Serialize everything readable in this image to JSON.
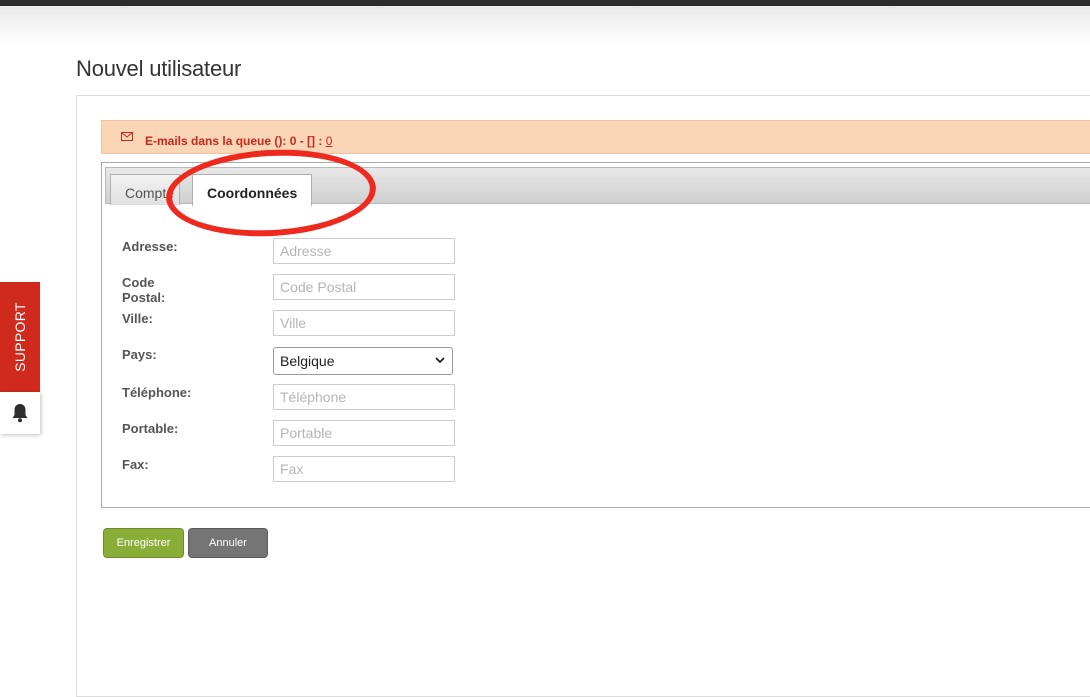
{
  "page": {
    "title": "Nouvel utilisateur"
  },
  "alert": {
    "text": "E-mails dans la queue (): 0 - [] : ",
    "count": "0"
  },
  "tabs": [
    {
      "label": "Compte",
      "active": false
    },
    {
      "label": "Coordonnées",
      "active": true
    }
  ],
  "form": {
    "fields": [
      {
        "label": "Adresse:",
        "placeholder": "Adresse"
      },
      {
        "label": "Code Postal:",
        "placeholder": "Code Postal"
      },
      {
        "label": "Ville:",
        "placeholder": "Ville"
      },
      {
        "label": "Pays:",
        "value": "Belgique"
      },
      {
        "label": "Téléphone:",
        "placeholder": "Téléphone"
      },
      {
        "label": "Portable:",
        "placeholder": "Portable"
      },
      {
        "label": "Fax:",
        "placeholder": "Fax"
      }
    ]
  },
  "buttons": {
    "save": "Enregistrer",
    "cancel": "Annuler"
  },
  "support": {
    "label": "SUPPORT"
  },
  "colors": {
    "accent_red": "#cf2a1d",
    "save_green": "#8aad38",
    "alert_bg": "#fad5b6",
    "annotation": "#ee2a1f"
  },
  "icons": {
    "alert": "envelope-icon",
    "notifications": "bell-icon",
    "select": "chevron-down-icon"
  }
}
